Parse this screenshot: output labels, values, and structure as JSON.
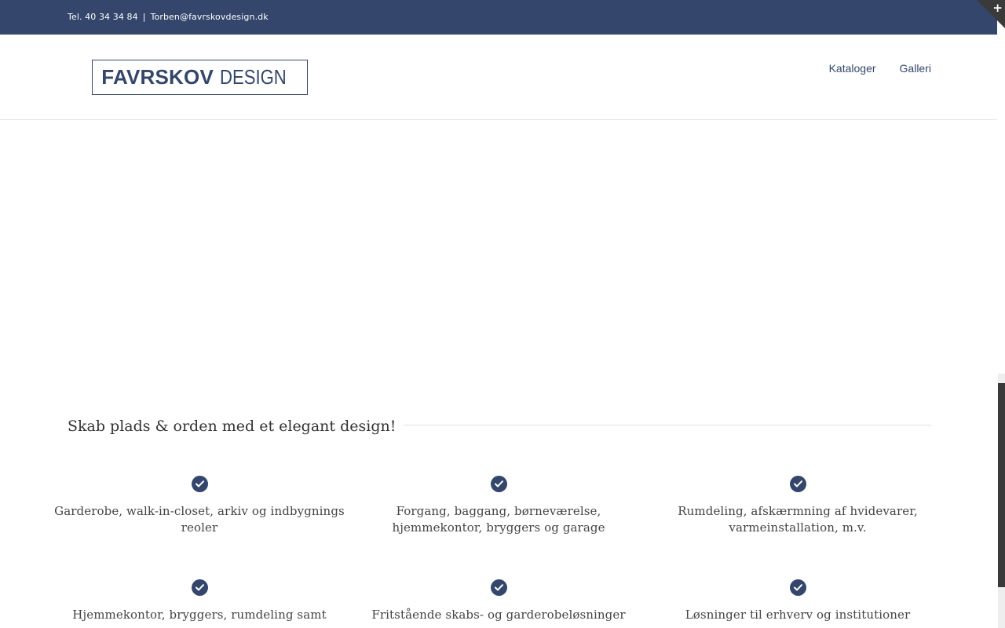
{
  "topbar": {
    "phone": "Tel. 40 34 34 84",
    "separator": "|",
    "email": "Torben@favrskovdesign.dk",
    "corner_icon": "plus-icon"
  },
  "logo": {
    "bold": "FAVRSKOV",
    "light": "DESIGN"
  },
  "nav": {
    "items": [
      {
        "label": "Kataloger"
      },
      {
        "label": "Galleri"
      }
    ]
  },
  "section": {
    "title": "Skab plads & orden med et elegant design!"
  },
  "features": [
    {
      "icon": "check-icon",
      "text": "Garderobe, walk-in-closet, arkiv og indbygnings reoler"
    },
    {
      "icon": "check-icon",
      "text": "Forgang, baggang, børneværelse, hjemmekontor, bryggers og garage"
    },
    {
      "icon": "check-icon",
      "text": "Rumdeling, afskærmning af hvidevarer, varmeinstallation, m.v."
    },
    {
      "icon": "check-icon",
      "text": "Hjemmekontor, bryggers, rumdeling samt"
    },
    {
      "icon": "check-icon",
      "text": "Fritstående skabs- og garderobeløsninger"
    },
    {
      "icon": "check-icon",
      "text": "Løsninger til erhverv og institutioner"
    }
  ],
  "colors": {
    "brand": "#34466b",
    "corner": "#3a3a3a"
  }
}
